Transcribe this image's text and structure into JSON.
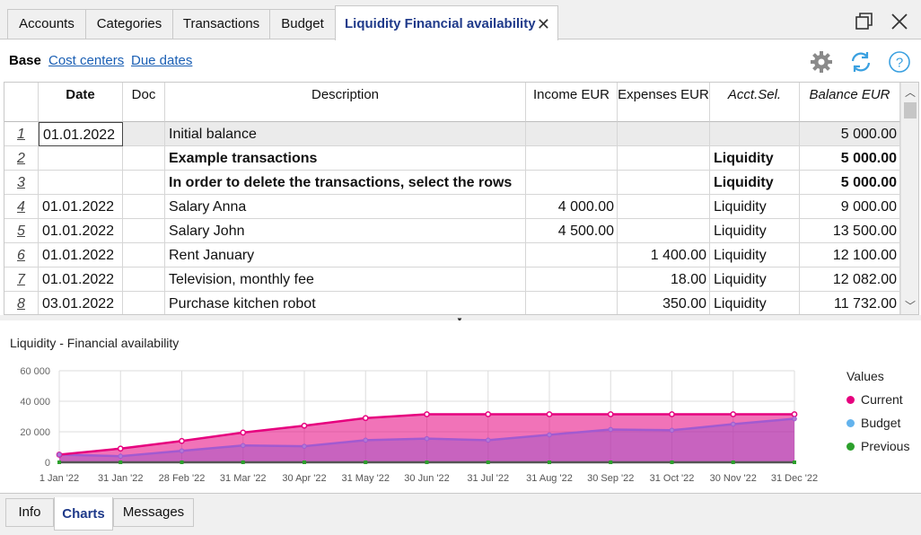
{
  "tabs": [
    {
      "label": "Accounts"
    },
    {
      "label": "Categories"
    },
    {
      "label": "Transactions"
    },
    {
      "label": "Budget"
    },
    {
      "label": "Liquidity Financial availability"
    }
  ],
  "subnav": {
    "base": "Base",
    "cost_centers": "Cost centers",
    "due_dates": "Due dates"
  },
  "table": {
    "headers": {
      "date": "Date",
      "doc": "Doc",
      "description": "Description",
      "income": "Income EUR",
      "expenses": "Expenses EUR",
      "acct": "Acct.Sel.",
      "balance": "Balance EUR"
    },
    "rows": [
      {
        "n": "1",
        "date": "01.01.2022",
        "doc": "",
        "desc": "Initial balance",
        "income": "",
        "expenses": "",
        "acct": "",
        "balance": "5 000.00"
      },
      {
        "n": "2",
        "date": "",
        "doc": "",
        "desc": "Example transactions",
        "income": "",
        "expenses": "",
        "acct": "Liquidity",
        "balance": "5 000.00"
      },
      {
        "n": "3",
        "date": "",
        "doc": "",
        "desc": "In order to delete the transactions, select the rows",
        "income": "",
        "expenses": "",
        "acct": "Liquidity",
        "balance": "5 000.00"
      },
      {
        "n": "4",
        "date": "01.01.2022",
        "doc": "",
        "desc": "Salary Anna",
        "income": "4 000.00",
        "expenses": "",
        "acct": "Liquidity",
        "balance": "9 000.00"
      },
      {
        "n": "5",
        "date": "01.01.2022",
        "doc": "",
        "desc": "Salary John",
        "income": "4 500.00",
        "expenses": "",
        "acct": "Liquidity",
        "balance": "13 500.00"
      },
      {
        "n": "6",
        "date": "01.01.2022",
        "doc": "",
        "desc": "Rent January",
        "income": "",
        "expenses": "1 400.00",
        "acct": "Liquidity",
        "balance": "12 100.00"
      },
      {
        "n": "7",
        "date": "01.01.2022",
        "doc": "",
        "desc": "Television, monthly fee",
        "income": "",
        "expenses": "18.00",
        "acct": "Liquidity",
        "balance": "12 082.00"
      },
      {
        "n": "8",
        "date": "03.01.2022",
        "doc": "",
        "desc": "Purchase kitchen robot",
        "income": "",
        "expenses": "350.00",
        "acct": "Liquidity",
        "balance": "11 732.00"
      }
    ]
  },
  "chart_title": "Liquidity - Financial availability",
  "chart_data": {
    "type": "area",
    "title": "Liquidity - Financial availability",
    "categories": [
      "1 Jan '22",
      "31 Jan '22",
      "28 Feb '22",
      "31 Mar '22",
      "30 Apr '22",
      "31 May '22",
      "30 Jun '22",
      "31 Jul '22",
      "31 Aug '22",
      "30 Sep '22",
      "31 Oct '22",
      "30 Nov '22",
      "31 Dec '22"
    ],
    "ylim": [
      0,
      60000
    ],
    "yticks": [
      "0",
      "20 000",
      "40 000",
      "60 000"
    ],
    "grid": true,
    "legend_title": "Values",
    "legend_position": "right",
    "series": [
      {
        "name": "Current",
        "color": "#e6007e",
        "values": [
          5000,
          9000,
          14000,
          19500,
          24000,
          29000,
          31500,
          31500,
          31500,
          31500,
          31500,
          31500,
          31500
        ]
      },
      {
        "name": "Budget",
        "color": "#63b3ed",
        "values": [
          5000,
          4000,
          7500,
          11000,
          10500,
          14500,
          15500,
          14500,
          18000,
          21500,
          21000,
          25000,
          28500
        ]
      },
      {
        "name": "Previous",
        "color": "#2ca02c",
        "values": [
          0,
          0,
          0,
          0,
          0,
          0,
          0,
          0,
          0,
          0,
          0,
          0,
          0
        ]
      }
    ]
  },
  "bottom_tabs": [
    {
      "label": "Info"
    },
    {
      "label": "Charts"
    },
    {
      "label": "Messages"
    }
  ],
  "colors": {
    "active_tab_text": "#1f3a8a",
    "link": "#1a5fb4",
    "current": "#e6007e",
    "budget": "#63b3ed",
    "previous": "#2ca02c"
  }
}
